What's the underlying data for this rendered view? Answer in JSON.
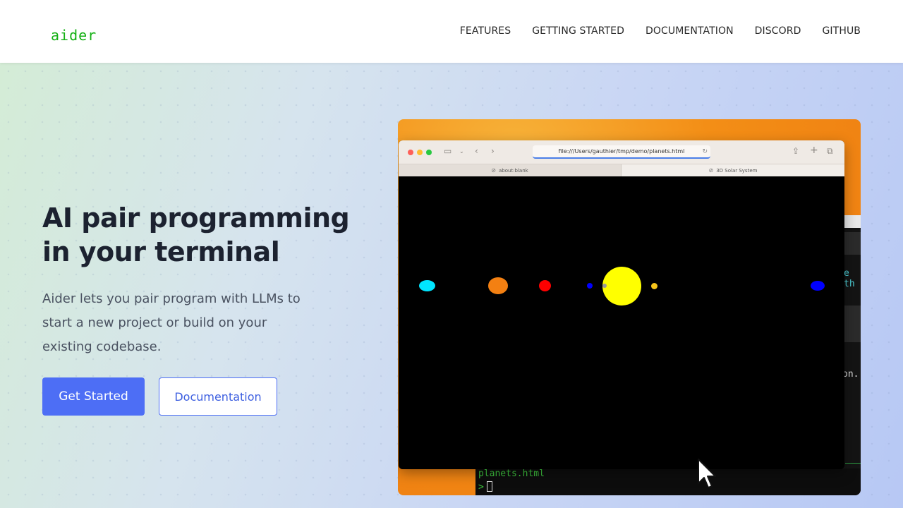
{
  "nav": {
    "logo": "aider",
    "links": [
      "FEATURES",
      "GETTING STARTED",
      "DOCUMENTATION",
      "DISCORD",
      "GITHUB"
    ]
  },
  "hero": {
    "headline": "AI pair programming in your terminal",
    "subtext": "Aider lets you pair program with LLMs to start a new project or build on your existing codebase.",
    "primary_button": "Get Started",
    "secondary_button": "Documentation"
  },
  "browser": {
    "url": "file:///Users/gauthier/tmp/demo/planets.html",
    "tabs": [
      "about:blank",
      "3D Solar System"
    ],
    "planets": [
      {
        "name": "cyan-planet",
        "color": "#00e5ff"
      },
      {
        "name": "orange-planet",
        "color": "#f38012"
      },
      {
        "name": "red-planet",
        "color": "#ff0000"
      },
      {
        "name": "blue-planet-small",
        "color": "#0000ff"
      },
      {
        "name": "gray-moon",
        "color": "#9a9a9a"
      },
      {
        "name": "sun",
        "color": "#ffff00"
      },
      {
        "name": "gold-planet",
        "color": "#f7c51b"
      },
      {
        "name": "blue-planet",
        "color": "#0000ff"
      }
    ]
  },
  "terminal": {
    "fragment_top": "e th",
    "fragment_mid": "on.",
    "file_line": "planets.html",
    "prompt": ">"
  },
  "colors": {
    "accent": "#4d6ef5",
    "logo": "#14b014",
    "heading": "#1c2230"
  }
}
